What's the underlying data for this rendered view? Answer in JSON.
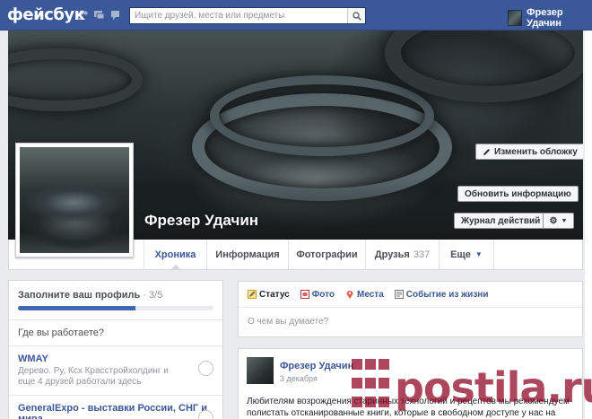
{
  "topbar": {
    "logo": "фейсбук",
    "search_placeholder": "Ищите друзей, места или предметы",
    "user_name": "Фрезер Удачин"
  },
  "cover": {
    "change_cover_label": "Изменить обложку",
    "update_info_label": "Обновить информацию",
    "activity_log_label": "Журнал действий",
    "profile_name": "Фрезер Удачин"
  },
  "nav": {
    "tabs": [
      {
        "label": "Хроника"
      },
      {
        "label": "Информация"
      },
      {
        "label": "Фотографии"
      },
      {
        "label": "Друзья",
        "count": "337"
      },
      {
        "label": "Еще"
      }
    ]
  },
  "profile_progress": {
    "title": "Заполните ваш профиль",
    "fraction": "· 3/5",
    "progress": 0.6
  },
  "left_rows": {
    "work_question": "Где вы работаете?",
    "items": [
      {
        "title": "WMAY",
        "sub": "Дерево. Ру, Ксх Красстройхолдинг и еще 4 друзей работали здесь"
      },
      {
        "title": "GeneralExpo - выставки России, СНГ и мира",
        "sub": ""
      }
    ]
  },
  "composer": {
    "tabs": [
      "Статус",
      "Фото",
      "Места",
      "Событие из жизни"
    ],
    "placeholder": "О чем вы думаете?"
  },
  "post": {
    "author": "Фрезер Удачин",
    "date": "3 декабря",
    "text": "Любителям возрождения старинных технологий и рецептов мы рекомендуем полистать отсканированные книги, которые в свободном доступе у нас на сайте"
  },
  "watermark": "postila.ru",
  "colors": {
    "brand": "#3b5998",
    "watermark": "#8c001e"
  }
}
